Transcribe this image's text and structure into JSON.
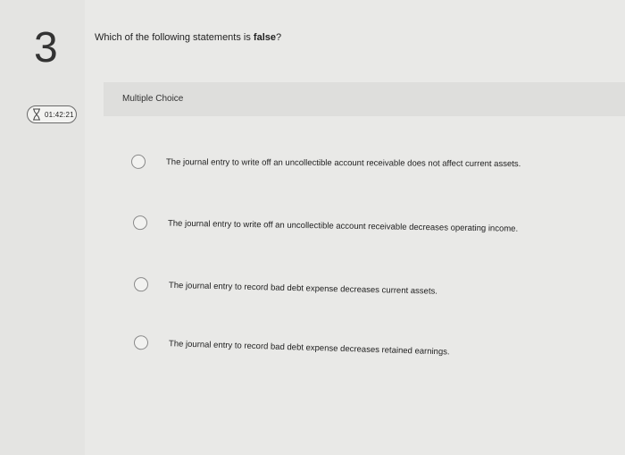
{
  "question": {
    "number": "3",
    "text_before": "Which of the following statements is ",
    "text_emphasis": "false",
    "text_after": "?"
  },
  "timer": {
    "icon": "hourglass-icon",
    "value": "01:42:21"
  },
  "answer_format": "Multiple Choice",
  "options": [
    {
      "text": "The journal entry to write off an uncollectible account receivable does not affect current assets."
    },
    {
      "text": "The journal entry to write off an uncollectible account receivable decreases operating income."
    },
    {
      "text": "The journal entry to record bad debt expense decreases current assets."
    },
    {
      "text": "The journal entry to record bad debt expense decreases retained earnings."
    }
  ]
}
